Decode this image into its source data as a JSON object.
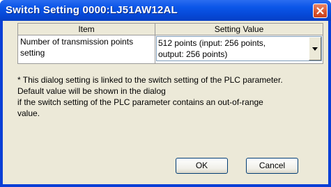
{
  "window": {
    "title": "Switch Setting 0000:LJ51AW12AL"
  },
  "table": {
    "headers": [
      "Item",
      "Setting Value"
    ],
    "rows": [
      {
        "item": "Number of transmission points setting",
        "value_line1": "512 points (input: 256 points,",
        "value_line2": "output: 256 points)"
      }
    ]
  },
  "note": {
    "lines": [
      "* This dialog setting is linked to the switch setting of the PLC parameter.",
      "Default value will be shown in the dialog",
      "if the switch setting of the PLC parameter contains an out-of-range",
      "value."
    ]
  },
  "buttons": {
    "ok": "OK",
    "cancel": "Cancel"
  }
}
